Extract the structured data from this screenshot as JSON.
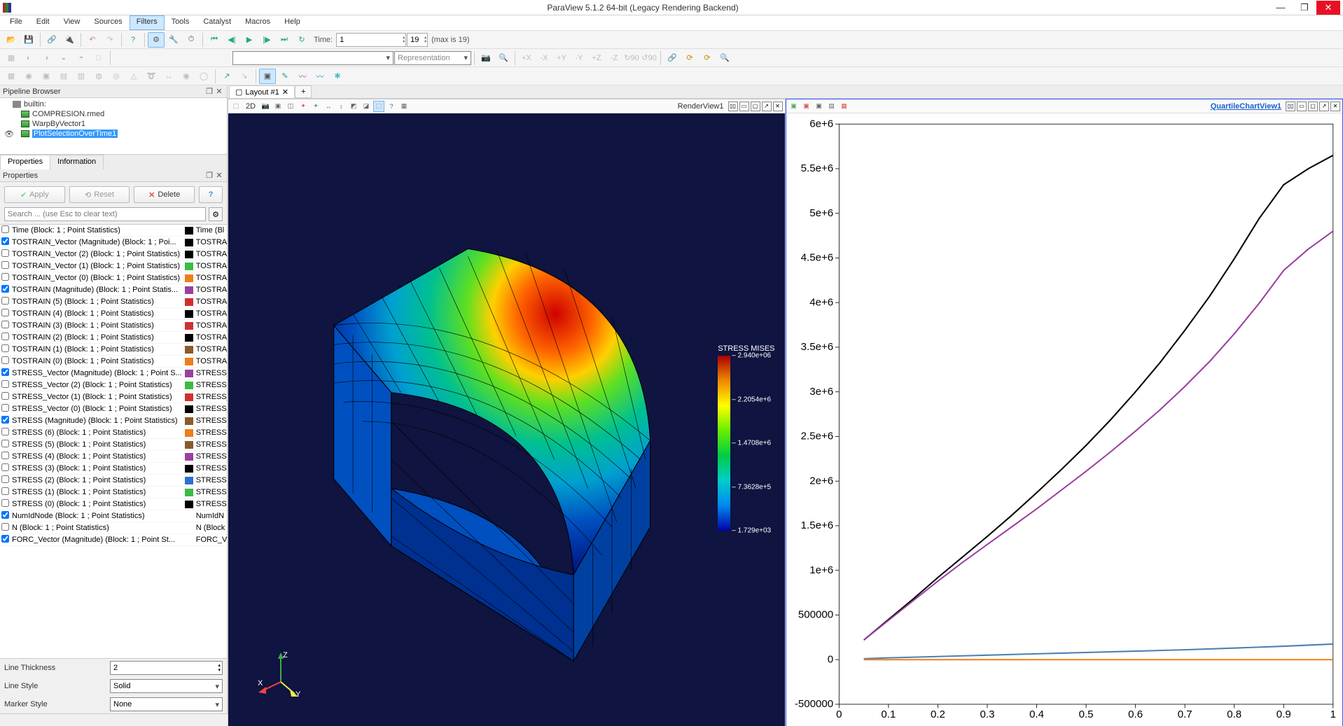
{
  "window": {
    "title": "ParaView 5.1.2 64-bit (Legacy Rendering Backend)"
  },
  "menu": [
    "File",
    "Edit",
    "View",
    "Sources",
    "Filters",
    "Tools",
    "Catalyst",
    "Macros",
    "Help"
  ],
  "menu_active": "Filters",
  "toolbar_time": {
    "label": "Time:",
    "value": "1",
    "index": "19",
    "max_label": "(max is 19)"
  },
  "representation": {
    "label": "Representation"
  },
  "pipeline": {
    "title": "Pipeline Browser",
    "items": [
      {
        "label": "builtin:",
        "root": true,
        "icon": "server"
      },
      {
        "label": "COMPRESION.rmed",
        "icon": "box"
      },
      {
        "label": "WarpByVector1",
        "icon": "box"
      },
      {
        "label": "PlotSelectionOverTime1",
        "icon": "box",
        "selected": true,
        "eye": true
      }
    ]
  },
  "tabs": {
    "properties": "Properties",
    "information": "Information"
  },
  "prop_panel_title": "Properties",
  "buttons": {
    "apply": "Apply",
    "reset": "Reset",
    "delete": "Delete"
  },
  "search_placeholder": "Search ... (use Esc to clear text)",
  "variables": [
    {
      "chk": false,
      "name": "Time (Block: 1 ; Point Statistics)",
      "color": "#000000",
      "col2": "Time (Bl"
    },
    {
      "chk": true,
      "name": "TOSTRAIN_Vector (Magnitude) (Block: 1 ; Poi...",
      "color": "#000000",
      "col2": "TOSTRA"
    },
    {
      "chk": false,
      "name": "TOSTRAIN_Vector (2) (Block: 1 ; Point Statistics)",
      "color": "#000000",
      "col2": "TOSTRA"
    },
    {
      "chk": false,
      "name": "TOSTRAIN_Vector (1) (Block: 1 ; Point Statistics)",
      "color": "#3bbd44",
      "col2": "TOSTRA"
    },
    {
      "chk": false,
      "name": "TOSTRAIN_Vector (0) (Block: 1 ; Point Statistics)",
      "color": "#ef7d1a",
      "col2": "TOSTRA"
    },
    {
      "chk": true,
      "name": "TOSTRAIN (Magnitude) (Block: 1 ; Point Statis...",
      "color": "#9b3fa0",
      "col2": "TOSTRA"
    },
    {
      "chk": false,
      "name": "TOSTRAIN (5) (Block: 1 ; Point Statistics)",
      "color": "#d12f2f",
      "col2": "TOSTRA"
    },
    {
      "chk": false,
      "name": "TOSTRAIN (4) (Block: 1 ; Point Statistics)",
      "color": "#000000",
      "col2": "TOSTRA"
    },
    {
      "chk": false,
      "name": "TOSTRAIN (3) (Block: 1 ; Point Statistics)",
      "color": "#d12f2f",
      "col2": "TOSTRA"
    },
    {
      "chk": false,
      "name": "TOSTRAIN (2) (Block: 1 ; Point Statistics)",
      "color": "#000000",
      "col2": "TOSTRA"
    },
    {
      "chk": false,
      "name": "TOSTRAIN (1) (Block: 1 ; Point Statistics)",
      "color": "#8b5a2b",
      "col2": "TOSTRA"
    },
    {
      "chk": false,
      "name": "TOSTRAIN (0) (Block: 1 ; Point Statistics)",
      "color": "#ef7d1a",
      "col2": "TOSTRA"
    },
    {
      "chk": true,
      "name": "STRESS_Vector (Magnitude) (Block: 1 ; Point S...",
      "color": "#9b3fa0",
      "col2": "STRESS_\\"
    },
    {
      "chk": false,
      "name": "STRESS_Vector (2) (Block: 1 ; Point Statistics)",
      "color": "#3bbd44",
      "col2": "STRESS_\\"
    },
    {
      "chk": false,
      "name": "STRESS_Vector (1) (Block: 1 ; Point Statistics)",
      "color": "#d12f2f",
      "col2": "STRESS_\\"
    },
    {
      "chk": false,
      "name": "STRESS_Vector (0) (Block: 1 ; Point Statistics)",
      "color": "#000000",
      "col2": "STRESS_\\"
    },
    {
      "chk": true,
      "name": "STRESS (Magnitude) (Block: 1 ; Point Statistics)",
      "color": "#8b5a2b",
      "col2": "STRESS ("
    },
    {
      "chk": false,
      "name": "STRESS (6) (Block: 1 ; Point Statistics)",
      "color": "#ef7d1a",
      "col2": "STRESS ("
    },
    {
      "chk": false,
      "name": "STRESS (5) (Block: 1 ; Point Statistics)",
      "color": "#8b5a2b",
      "col2": "STRESS ("
    },
    {
      "chk": false,
      "name": "STRESS (4) (Block: 1 ; Point Statistics)",
      "color": "#9b3fa0",
      "col2": "STRESS ("
    },
    {
      "chk": false,
      "name": "STRESS (3) (Block: 1 ; Point Statistics)",
      "color": "#000000",
      "col2": "STRESS ("
    },
    {
      "chk": false,
      "name": "STRESS (2) (Block: 1 ; Point Statistics)",
      "color": "#2f6fd1",
      "col2": "STRESS ("
    },
    {
      "chk": false,
      "name": "STRESS (1) (Block: 1 ; Point Statistics)",
      "color": "#3bbd44",
      "col2": "STRESS ("
    },
    {
      "chk": false,
      "name": "STRESS (0) (Block: 1 ; Point Statistics)",
      "color": "#000000",
      "col2": "STRESS ("
    },
    {
      "chk": true,
      "name": "NumIdNode (Block: 1 ; Point Statistics)",
      "color": "",
      "col2": "NumIdN"
    },
    {
      "chk": false,
      "name": "N (Block: 1 ; Point Statistics)",
      "color": "",
      "col2": "N (Block"
    },
    {
      "chk": true,
      "name": "FORC_Vector (Magnitude) (Block: 1 ; Point St...",
      "color": "",
      "col2": "FORC_Ve"
    }
  ],
  "form": {
    "line_thickness_label": "Line Thickness",
    "line_thickness": "2",
    "line_style_label": "Line Style",
    "line_style": "Solid",
    "marker_style_label": "Marker Style",
    "marker_style": "None"
  },
  "layout": {
    "tab": "Layout #1"
  },
  "views": {
    "render": {
      "title": "RenderView1",
      "mode": "2D",
      "legend_title": "STRESS MISES",
      "legend_ticks": [
        "2.940e+06",
        "2.2054e+6",
        "1.4708e+6",
        "7.3628e+5",
        "1.729e+03"
      ]
    },
    "chart": {
      "title": "QuartileChartView1"
    }
  },
  "axes": {
    "x": "X",
    "y": "Y",
    "z": "Z"
  },
  "chart_data": {
    "type": "line",
    "xlabel": "",
    "ylabel": "",
    "xlim": [
      0,
      1
    ],
    "ylim": [
      -500000,
      6000000
    ],
    "xticks": [
      0,
      0.1,
      0.2,
      0.3,
      0.4,
      0.5,
      0.6,
      0.7,
      0.8,
      0.9,
      1
    ],
    "xtick_labels": [
      "0",
      "0.1",
      "0.2",
      "0.3",
      "0.4",
      "0.5",
      "0.6",
      "0.7",
      "0.8",
      "0.9",
      "1"
    ],
    "yticks": [
      -500000,
      0,
      500000,
      1000000,
      1500000,
      2000000,
      2500000,
      3000000,
      3500000,
      4000000,
      4500000,
      5000000,
      5500000,
      6000000
    ],
    "ytick_labels": [
      "-500000",
      "0",
      "500000",
      "1e+6",
      "1.5e+6",
      "2e+6",
      "2.5e+6",
      "3e+6",
      "3.5e+6",
      "4e+6",
      "4.5e+6",
      "5e+6",
      "5.5e+6",
      "6e+6"
    ],
    "series": [
      {
        "name": "STRESS (Magnitude)",
        "color": "#000000",
        "x": [
          0.05,
          0.1,
          0.15,
          0.2,
          0.25,
          0.3,
          0.35,
          0.4,
          0.45,
          0.5,
          0.55,
          0.6,
          0.65,
          0.7,
          0.75,
          0.8,
          0.85,
          0.9,
          0.95,
          1.0
        ],
        "y": [
          220000,
          450000,
          680000,
          920000,
          1150000,
          1380000,
          1620000,
          1870000,
          2130000,
          2400000,
          2690000,
          3000000,
          3330000,
          3690000,
          4070000,
          4490000,
          4940000,
          5320000,
          5500000,
          5650000
        ]
      },
      {
        "name": "STRESS_Vector (Magnitude)",
        "color": "#9b3fa0",
        "x": [
          0.05,
          0.1,
          0.15,
          0.2,
          0.25,
          0.3,
          0.35,
          0.4,
          0.45,
          0.5,
          0.55,
          0.6,
          0.65,
          0.7,
          0.75,
          0.8,
          0.85,
          0.9,
          0.95,
          1.0
        ],
        "y": [
          220000,
          440000,
          660000,
          880000,
          1090000,
          1290000,
          1490000,
          1690000,
          1900000,
          2110000,
          2330000,
          2560000,
          2800000,
          3060000,
          3340000,
          3650000,
          3990000,
          4360000,
          4600000,
          4800000
        ]
      },
      {
        "name": "TOSTRAIN_Vector (Magnitude)",
        "color": "#4a7fb5",
        "x": [
          0.05,
          0.1,
          0.2,
          0.3,
          0.4,
          0.5,
          0.6,
          0.7,
          0.8,
          0.9,
          1.0
        ],
        "y": [
          10000,
          20000,
          35000,
          50000,
          65000,
          80000,
          95000,
          110000,
          130000,
          150000,
          175000
        ]
      },
      {
        "name": "FORC_Vector (Magnitude)",
        "color": "#ef7d1a",
        "x": [
          0.05,
          0.5,
          1.0
        ],
        "y": [
          0,
          0,
          0
        ]
      }
    ]
  }
}
